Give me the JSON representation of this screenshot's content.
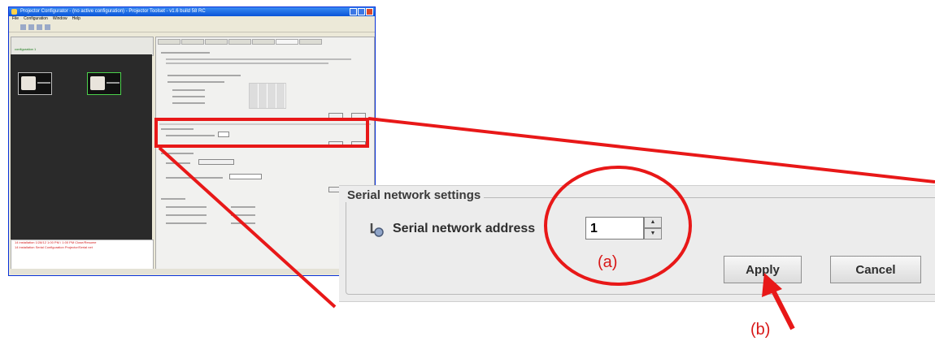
{
  "background_window": {
    "title": "Projector Configurator - (no active configuration) - Projector Toolset - v1.6 build 58 RC",
    "menu": [
      "File",
      "Configuration",
      "Window",
      "Help"
    ],
    "left_label": "configuration 1",
    "log_lines": [
      "14 installation 1/28/12 1:00 PM / 1:00 PM Close/Resume",
      "14 installation Serial Configuration Projector/Serial net"
    ]
  },
  "serial_network": {
    "group_title": "Serial network settings",
    "address_label": "Serial network address",
    "address_value": "1",
    "apply_label": "Apply",
    "cancel_label": "Cancel"
  },
  "markers": {
    "a": "(a)",
    "b": "(b)"
  },
  "colors": {
    "annotation": "#e81818",
    "panel_bg": "#ececec"
  },
  "icons": {
    "network": "serial-network-icon",
    "spin_up": "spinner-up-icon",
    "spin_down": "spinner-down-icon"
  }
}
